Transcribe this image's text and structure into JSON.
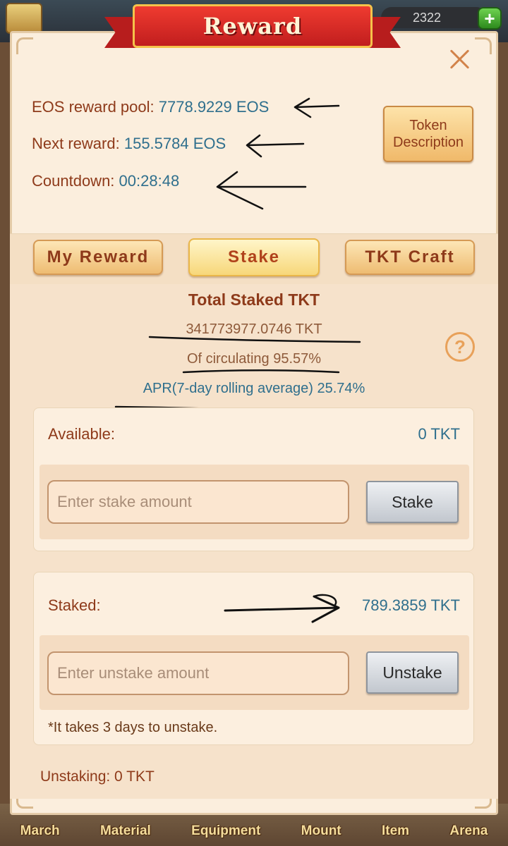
{
  "resources": {
    "amount": "2322"
  },
  "dialog": {
    "title": "Reward",
    "token_button": [
      "Token",
      "Description"
    ]
  },
  "info": {
    "pool_label": "EOS reward pool:",
    "pool_value": "7778.9229 EOS",
    "next_label": "Next reward:",
    "next_value": "155.5784 EOS",
    "countdown_label": "Countdown:",
    "countdown_value": "00:28:48"
  },
  "tabs": [
    {
      "label": "My Reward",
      "active": false
    },
    {
      "label": "Stake",
      "active": true
    },
    {
      "label": "TKT Craft",
      "active": false
    }
  ],
  "stake": {
    "heading": "Total Staked TKT",
    "total": "341773977.0746 TKT",
    "circulating": "Of circulating 95.57%",
    "apr": "APR(7-day rolling average) 25.74%",
    "available_label": "Available:",
    "available_value": "0 TKT",
    "stake_placeholder": "Enter stake amount",
    "stake_button": "Stake",
    "staked_label": "Staked:",
    "staked_value": "789.3859 TKT",
    "unstake_placeholder": "Enter unstake amount",
    "unstake_button": "Unstake",
    "note": "*It takes 3 days to unstake.",
    "unstaking": "Unstaking: 0 TKT"
  },
  "bottom_nav": [
    "March",
    "Material",
    "Equipment",
    "Mount",
    "Item",
    "Arena"
  ],
  "colors": {
    "label": "#8e3a1a",
    "value": "#2f6f8d",
    "ribbon": "#d0261f"
  }
}
